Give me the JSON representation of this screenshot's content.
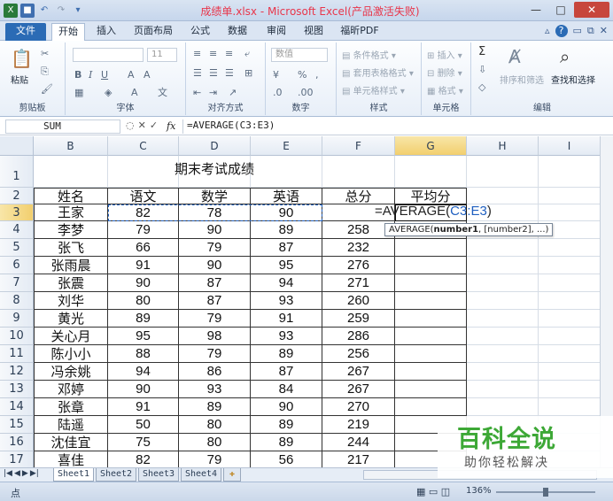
{
  "window": {
    "title": "成绩单.xlsx - Microsoft Excel(产品激活失败)",
    "controls": [
      "—",
      "□",
      "✕"
    ]
  },
  "qat": {
    "save_icon": "save-icon",
    "undo_icon": "undo-icon",
    "redo_icon": "redo-icon"
  },
  "tabs": {
    "file": "文件",
    "home": "开始",
    "insert": "插入",
    "layout": "页面布局",
    "formulas": "公式",
    "data": "数据",
    "review": "审阅",
    "view": "视图",
    "pdf": "福昕PDF"
  },
  "ribbon": {
    "clipboard": {
      "label": "剪贴板",
      "paste": "粘贴"
    },
    "font": {
      "label": "字体",
      "size": "11",
      "bold": "B",
      "italic": "I",
      "underline": "U"
    },
    "alignment": {
      "label": "对齐方式"
    },
    "number": {
      "label": "数字",
      "format": "数值"
    },
    "styles": {
      "label": "样式",
      "conditional": "条件格式",
      "table": "套用表格格式",
      "cell": "单元格样式"
    },
    "cells": {
      "label": "单元格",
      "insert": "插入",
      "delete": "删除",
      "format": "格式"
    },
    "editing": {
      "label": "编辑",
      "sort": "排序和筛选",
      "find": "查找和选择",
      "sum": "Σ"
    }
  },
  "formula_bar": {
    "name_box": "SUM",
    "fx": "fx",
    "formula": "=AVERAGE(C3:E3)"
  },
  "columns": [
    "B",
    "C",
    "D",
    "E",
    "F",
    "G",
    "H",
    "I"
  ],
  "selected_column": "G",
  "rows": [
    "1",
    "2",
    "3",
    "4",
    "5",
    "6",
    "7",
    "8",
    "9",
    "10",
    "11",
    "12",
    "13",
    "14",
    "15",
    "16",
    "17"
  ],
  "selected_row": "3",
  "sheet": {
    "title": "期末考试成绩",
    "headers": [
      "姓名",
      "语文",
      "数学",
      "英语",
      "总分",
      "平均分"
    ],
    "records": [
      [
        "王家",
        "82",
        "78",
        "90",
        ""
      ],
      [
        "李梦",
        "79",
        "90",
        "89",
        "258"
      ],
      [
        "张飞",
        "66",
        "79",
        "87",
        "232"
      ],
      [
        "张雨晨",
        "91",
        "90",
        "95",
        "276"
      ],
      [
        "张震",
        "90",
        "87",
        "94",
        "271"
      ],
      [
        "刘华",
        "80",
        "87",
        "93",
        "260"
      ],
      [
        "黄光",
        "89",
        "79",
        "91",
        "259"
      ],
      [
        "关心月",
        "95",
        "98",
        "93",
        "286"
      ],
      [
        "陈小小",
        "88",
        "79",
        "89",
        "256"
      ],
      [
        "冯余姚",
        "94",
        "86",
        "87",
        "267"
      ],
      [
        "邓婷",
        "90",
        "93",
        "84",
        "267"
      ],
      [
        "张章",
        "91",
        "89",
        "90",
        "270"
      ],
      [
        "陆遥",
        "50",
        "80",
        "89",
        "219"
      ],
      [
        "沈佳宜",
        "75",
        "80",
        "89",
        "244"
      ],
      [
        "喜佳",
        "82",
        "79",
        "56",
        "217"
      ]
    ]
  },
  "editing": {
    "prefix": "=AVERAGE(",
    "ref": "C3:E3",
    "suffix": ")",
    "tooltip_fn": "AVERAGE(",
    "tooltip_arg1": "number1",
    "tooltip_rest": ", [number2], ...)"
  },
  "sheet_tabs": [
    "Sheet1",
    "Sheet2",
    "Sheet3",
    "Sheet4"
  ],
  "active_sheet": "Sheet1",
  "status": {
    "mode": "点",
    "zoom": "136%",
    "zoom_fraction": 0.5
  },
  "watermark": {
    "line1": "百科全说",
    "line2": "助你轻松解决"
  }
}
